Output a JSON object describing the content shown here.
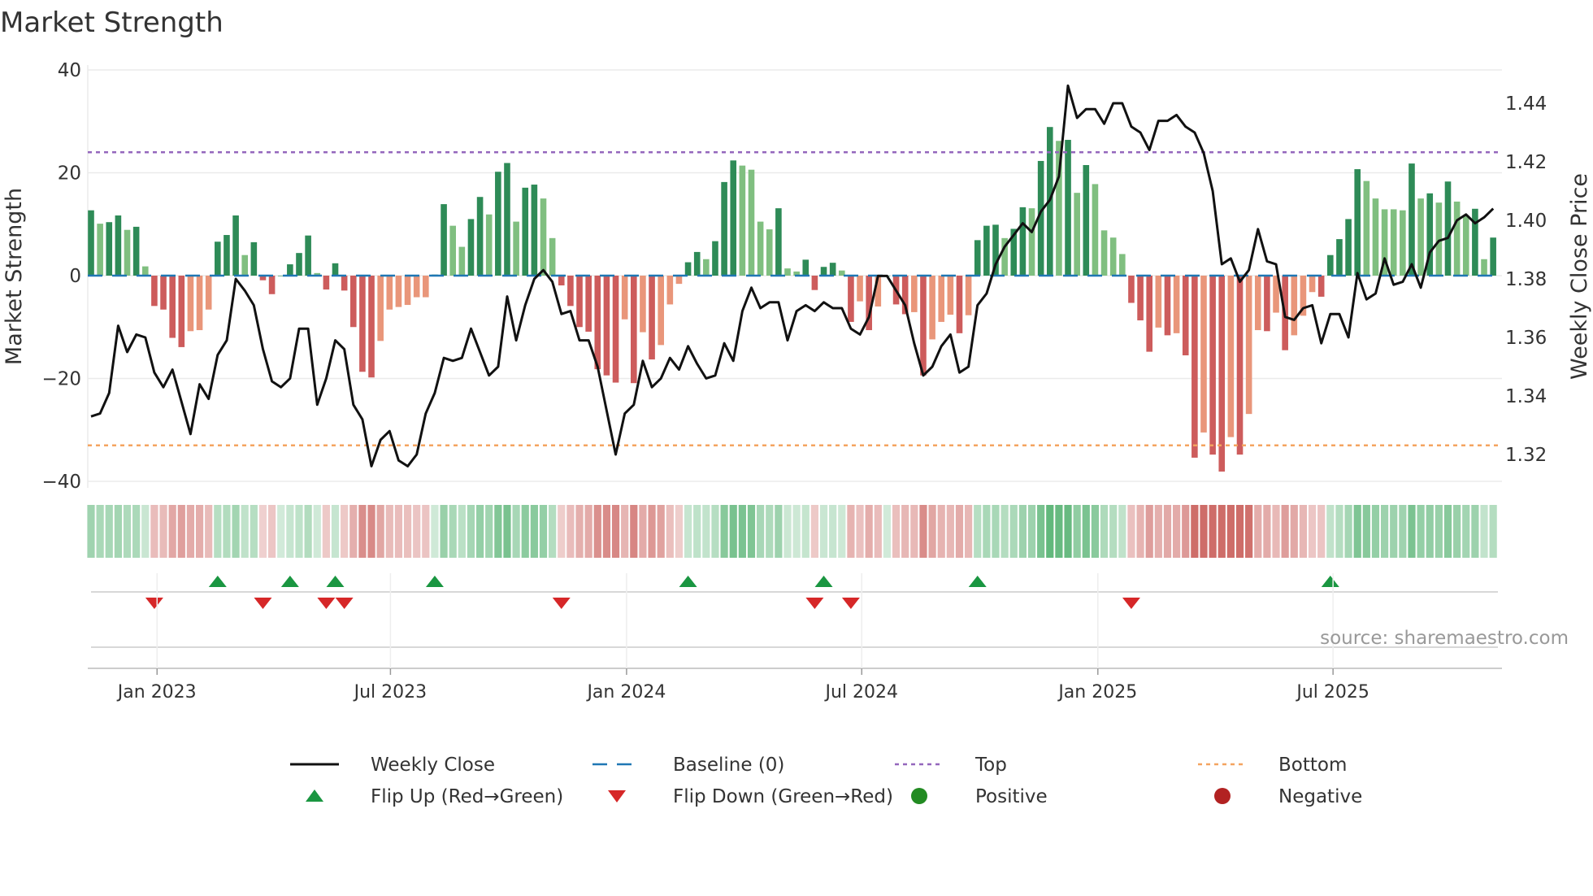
{
  "chart_data": {
    "type": "bar",
    "title": "Market Strength",
    "ylabel": "Market Strength",
    "y2label": "Weekly Close Price",
    "ylim": [
      -40,
      40
    ],
    "y2lim": [
      1.32,
      1.44
    ],
    "yticks": [
      "40",
      "20",
      "0",
      "−20",
      "−40"
    ],
    "yticks_values": [
      40,
      20,
      0,
      -20,
      -40
    ],
    "y2ticks": [
      "1.44",
      "1.42",
      "1.40",
      "1.38",
      "1.36",
      "1.34",
      "1.32"
    ],
    "y2ticks_values": [
      1.44,
      1.42,
      1.4,
      1.38,
      1.36,
      1.34,
      1.32
    ],
    "xticks": [
      {
        "label": "Jan 2023",
        "week": 7.3
      },
      {
        "label": "Jul 2023",
        "week": 33.1
      },
      {
        "label": "Jan 2024",
        "week": 59.2
      },
      {
        "label": "Jul 2024",
        "week": 85.2
      },
      {
        "label": "Jan 2025",
        "week": 111.3
      },
      {
        "label": "Jul 2025",
        "week": 137.3
      }
    ],
    "grid": true,
    "top_level": 24,
    "bottom_level": -33,
    "baseline": 0,
    "strength": [
      12.7,
      10.1,
      10.4,
      11.7,
      8.9,
      9.5,
      1.8,
      -5.9,
      -6.6,
      -12.1,
      -13.9,
      -10.8,
      -10.6,
      -6.6,
      6.6,
      7.9,
      11.7,
      4.0,
      6.5,
      -0.9,
      -3.6,
      0,
      2.2,
      4.4,
      7.8,
      0.5,
      -2.7,
      2.4,
      -2.9,
      -10.0,
      -18.7,
      -19.8,
      -12.7,
      -6.6,
      -6.1,
      -5.7,
      -4.2,
      -4.2,
      0.2,
      13.9,
      9.7,
      5.6,
      11.0,
      15.3,
      11.9,
      20.2,
      21.9,
      10.5,
      17.1,
      17.7,
      15.0,
      7.3,
      -1.9,
      -5.9,
      -10.0,
      -10.9,
      -18.2,
      -19.4,
      -20.8,
      -8.5,
      -20.9,
      -11.0,
      -16.3,
      -13.5,
      -5.6,
      -1.6,
      2.6,
      4.6,
      3.2,
      6.7,
      18.2,
      22.4,
      21.4,
      20.6,
      10.5,
      9.0,
      13.1,
      1.4,
      0.8,
      3.1,
      -2.8,
      1.7,
      2.5,
      1.0,
      -9.0,
      -5.0,
      -10.6,
      -6.0,
      0,
      -5.6,
      -7.5,
      -7.1,
      -19.4,
      -12.4,
      -9.0,
      -7.6,
      -11.2,
      -7.7,
      6.9,
      9.7,
      9.9,
      7.3,
      9.1,
      13.3,
      13.1,
      22.3,
      28.9,
      26.2,
      26.4,
      16.1,
      21.5,
      17.8,
      8.8,
      7.4,
      4.2,
      -5.3,
      -8.7,
      -14.8,
      -10.1,
      -11.6,
      -11.2,
      -15.5,
      -35.4,
      -30.5,
      -34.8,
      -38.1,
      -31.4,
      -34.8,
      -26.9,
      -10.6,
      -10.8,
      -7.2,
      -14.5,
      -11.6,
      -7.8,
      -3.2,
      -4.1,
      4.0,
      7.1,
      11.0,
      20.7,
      18.4,
      15.0,
      12.9,
      12.9,
      12.7,
      21.8,
      15.0,
      16.0,
      14.2,
      18.3,
      14.4,
      11.7,
      13.0,
      3.2,
      7.4
    ],
    "weekly_close": [
      1.333,
      1.334,
      1.341,
      1.364,
      1.355,
      1.361,
      1.36,
      1.348,
      1.343,
      1.349,
      1.338,
      1.327,
      1.344,
      1.339,
      1.354,
      1.359,
      1.38,
      1.376,
      1.371,
      1.356,
      1.345,
      1.343,
      1.346,
      1.363,
      1.363,
      1.337,
      1.346,
      1.359,
      1.356,
      1.337,
      1.332,
      1.316,
      1.325,
      1.328,
      1.318,
      1.316,
      1.32,
      1.334,
      1.341,
      1.353,
      1.352,
      1.353,
      1.363,
      1.355,
      1.347,
      1.35,
      1.374,
      1.359,
      1.371,
      1.38,
      1.383,
      1.379,
      1.368,
      1.369,
      1.359,
      1.359,
      1.35,
      1.335,
      1.32,
      1.334,
      1.337,
      1.352,
      1.343,
      1.346,
      1.353,
      1.349,
      1.357,
      1.351,
      1.346,
      1.347,
      1.358,
      1.352,
      1.369,
      1.377,
      1.37,
      1.372,
      1.372,
      1.359,
      1.369,
      1.371,
      1.369,
      1.372,
      1.37,
      1.37,
      1.363,
      1.361,
      1.367,
      1.381,
      1.381,
      1.376,
      1.371,
      1.358,
      1.347,
      1.35,
      1.357,
      1.361,
      1.348,
      1.35,
      1.371,
      1.375,
      1.385,
      1.391,
      1.395,
      1.399,
      1.396,
      1.403,
      1.407,
      1.415,
      1.446,
      1.435,
      1.438,
      1.438,
      1.433,
      1.44,
      1.44,
      1.432,
      1.43,
      1.424,
      1.434,
      1.434,
      1.436,
      1.432,
      1.43,
      1.423,
      1.41,
      1.385,
      1.387,
      1.379,
      1.383,
      1.397,
      1.386,
      1.385,
      1.367,
      1.366,
      1.37,
      1.371,
      1.358,
      1.368,
      1.368,
      1.36,
      1.382,
      1.373,
      1.375,
      1.387,
      1.378,
      1.379,
      1.385,
      1.377,
      1.389,
      1.393,
      1.394,
      1.4,
      1.402,
      1.399,
      1.401,
      1.404
    ],
    "flip_up_weeks": [
      14,
      22,
      27,
      38,
      66,
      81,
      98,
      137
    ],
    "flip_down_weeks": [
      7,
      19,
      26,
      28,
      52,
      80,
      84,
      115
    ],
    "legend": {
      "placement": "bottom",
      "items": [
        {
          "label": "Weekly Close",
          "kind": "line"
        },
        {
          "label": "Baseline (0)",
          "kind": "dash"
        },
        {
          "label": "Top",
          "kind": "dot-purple"
        },
        {
          "label": "Bottom",
          "kind": "dot-orange"
        },
        {
          "label": "Flip Up (Red→Green)",
          "kind": "tri-up"
        },
        {
          "label": "Flip Down (Green→Red)",
          "kind": "tri-down"
        },
        {
          "label": "Positive",
          "kind": "circle-green"
        },
        {
          "label": "Negative",
          "kind": "circle-red"
        }
      ]
    },
    "source": "source: sharemaestro.com"
  },
  "colors": {
    "pos_strong": "#2e8b57",
    "pos_weak": "#80bf80",
    "neg_strong": "#cd5c5c",
    "neg_weak": "#e9967a",
    "baseline": "#1f77b4",
    "top": "#9467bd",
    "bottom": "#f4a460",
    "line": "#111111",
    "flip_up": "#1a9641",
    "flip_down": "#d62728",
    "positive": "#228b22",
    "negative": "#b22222"
  }
}
